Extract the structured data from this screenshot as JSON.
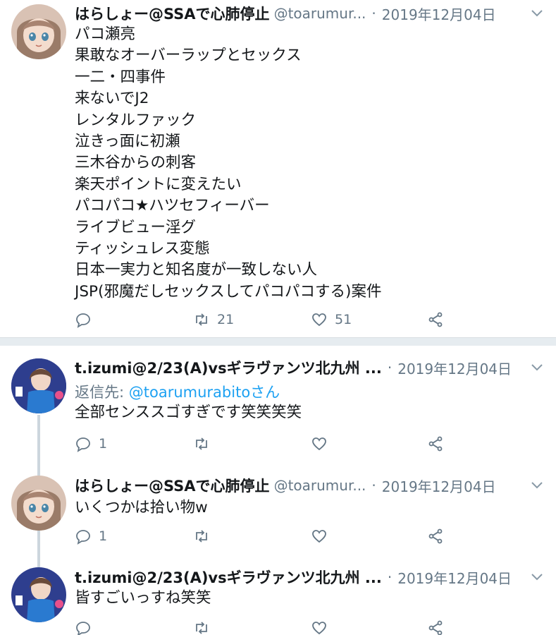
{
  "colors": {
    "text": "#14171a",
    "muted": "#657786",
    "link": "#1da1f2",
    "separator": "#e6ecf0",
    "thread_line": "#ccd6dd"
  },
  "tweets": [
    {
      "user_name": "はらしょー@SSAで心肺停止",
      "handle": "@toarumur...",
      "dot": "·",
      "date": "2019年12月04日",
      "lines": [
        "パコ瀬亮",
        "果敢なオーバーラップとセックス",
        "一二・四事件",
        "来ないでJ2",
        "レンタルファック",
        "泣きっ面に初瀬",
        "三木谷からの刺客",
        "楽天ポイントに変えたい",
        "パコパコ★ハツセフィーバー",
        "ライブビュー淫グ",
        "ティッシュレス変態",
        "日本一実力と知名度が一致しない人",
        "JSP(邪魔だしセックスしてパコパコする)案件"
      ],
      "reply_count": "",
      "retweet_count": "21",
      "like_count": "51"
    },
    {
      "user_name": "t.izumi@2/23(A)vsギラヴァンツ北九州 ...",
      "handle": "",
      "dot": "·",
      "date": "2019年12月04日",
      "reply_to_prefix": "返信先: ",
      "reply_to_user": "@toarumurabitoさん",
      "lines": [
        "全部センススゴすぎです笑笑笑笑"
      ],
      "reply_count": "1",
      "retweet_count": "",
      "like_count": ""
    },
    {
      "user_name": "はらしょー@SSAで心肺停止",
      "handle": "@toarumur...",
      "dot": "·",
      "date": "2019年12月04日",
      "lines": [
        "いくつかは拾い物w"
      ],
      "reply_count": "1",
      "retweet_count": "",
      "like_count": ""
    },
    {
      "user_name": "t.izumi@2/23(A)vsギラヴァンツ北九州 ...",
      "handle": "",
      "dot": "·",
      "date": "2019年12月04日",
      "lines": [
        "皆すごいっすね笑笑"
      ],
      "reply_count": "",
      "retweet_count": "",
      "like_count": ""
    }
  ],
  "icons": [
    "reply-icon",
    "retweet-icon",
    "like-icon",
    "share-icon",
    "chevron-down-icon"
  ]
}
